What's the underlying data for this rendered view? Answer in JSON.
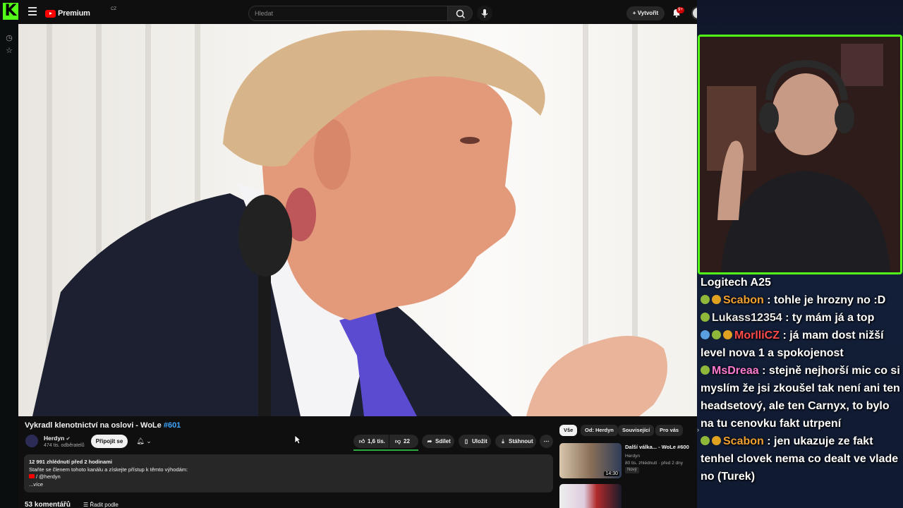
{
  "topbar": {
    "brand": "Premium",
    "region": "CZ",
    "search_placeholder": "Hledat",
    "create_label": "Vytvořit",
    "notif_count": "9+"
  },
  "video": {
    "title": "Vykradl klenotnictví na oslovi - WoLe ",
    "hashtag": "#601",
    "channel": {
      "name": "Herdyn",
      "subs": "474 tis. odběratelů",
      "join_label": "Připojit se"
    },
    "actions": {
      "likes": "1,6 tis.",
      "dislikes": "22",
      "share": "Sdílet",
      "save": "Uložit",
      "download": "Stáhnout"
    },
    "description": {
      "stats": "12 991 zhlédnutí  před 2 hodinami",
      "line1": "Staňte se členem tohoto kanálu a získejte přístup k těmto výhodám:",
      "link": "/ @herdyn",
      "more": "...více"
    },
    "comments_count": "53 komentářů",
    "sort_label": "Řadit podle"
  },
  "related": {
    "chips": [
      "Vše",
      "Od: Herdyn",
      "Související",
      "Pro vás"
    ],
    "items": [
      {
        "title": "Další válka... - WoLe #600",
        "channel": "Herdyn",
        "meta": "80 tis. zhlédnutí · před 2 dny",
        "badge": "Nový",
        "duration": "14:30"
      }
    ]
  },
  "chat": {
    "messages": [
      {
        "user": "",
        "text": "Logitech A25",
        "color": "#ffffff"
      },
      {
        "user": "Scabon",
        "text": ": tohle je hrozny no :D",
        "color": "#f0a030"
      },
      {
        "user": "Lukass12354",
        "text": ": ty mám já a top",
        "color": "#e8e8e8"
      },
      {
        "user": "MorlliCZ",
        "text": ": já mam dost nižší level nova 1 a spokojenost",
        "color": "#ff4a4a"
      },
      {
        "user": "MsDreaa",
        "text": ": stejně nejhorší mic co si myslím že jsi zkoušel tak není ani ten headsetový, ale ten Carnyx, to bylo na tu cenovku fakt utrpení",
        "color": "#ff7ad0"
      },
      {
        "user": "Scabon",
        "text": ": jen ukazuje ze fakt tenhel clovek nema co dealt ve vlade no (Turek)",
        "color": "#f0a030"
      }
    ]
  }
}
